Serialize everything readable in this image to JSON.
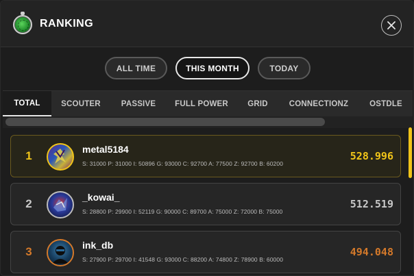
{
  "header": {
    "title": "RANKING",
    "icon": "radar-icon",
    "close_icon": "close-icon"
  },
  "period_filters": [
    {
      "label": "ALL TIME",
      "active": false
    },
    {
      "label": "THIS MONTH",
      "active": true
    },
    {
      "label": "TODAY",
      "active": false
    }
  ],
  "tabs": [
    {
      "label": "TOTAL",
      "active": true
    },
    {
      "label": "SCOUTER",
      "active": false
    },
    {
      "label": "PASSIVE",
      "active": false
    },
    {
      "label": "FULL POWER",
      "active": false
    },
    {
      "label": "GRID",
      "active": false
    },
    {
      "label": "CONNECTIONZ",
      "active": false
    },
    {
      "label": "OSTDLE",
      "active": false
    }
  ],
  "colors": {
    "gold": "#f0c419",
    "silver": "#c8c8c8",
    "bronze": "#d4792a",
    "scrollbar_accent": "#f0c419"
  },
  "rankings": [
    {
      "rank": "1",
      "name": "metal5184",
      "stats": "S: 31000  P: 31000  I: 50896  G: 93000  C: 92700  A: 77500  Z: 92700  B: 60200",
      "score": "528.996",
      "medal": "gold"
    },
    {
      "rank": "2",
      "name": "_kowai_",
      "stats": "S: 28800  P: 29900  I: 52119  G: 90000  C: 89700  A: 75000  Z: 72000  B: 75000",
      "score": "512.519",
      "medal": "silver"
    },
    {
      "rank": "3",
      "name": "ink_db",
      "stats": "S: 27900  P: 29700  I: 41548  G: 93000  C: 88200  A: 74800  Z: 78900  B: 60000",
      "score": "494.048",
      "medal": "bronze"
    }
  ]
}
